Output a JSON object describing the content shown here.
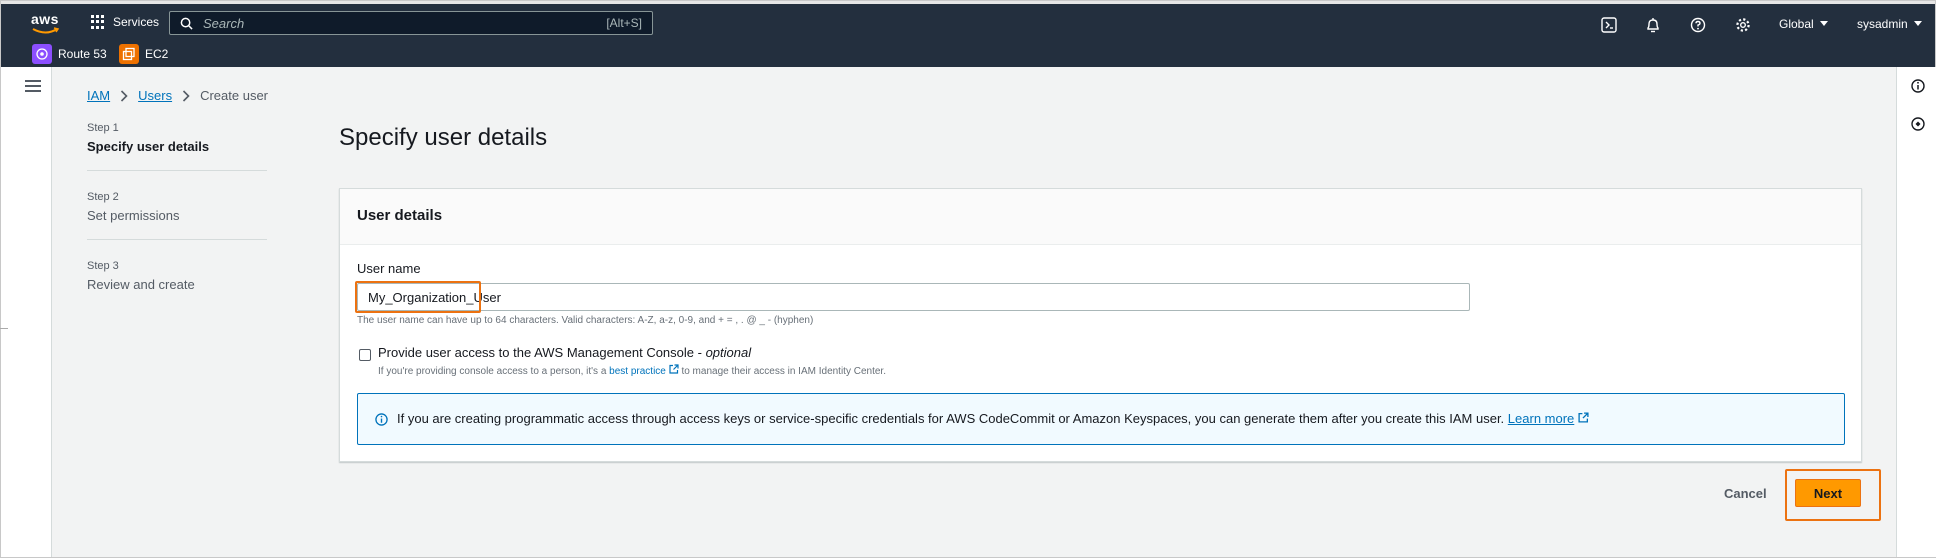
{
  "topnav": {
    "logo_text": "aws",
    "services_label": "Services",
    "search_placeholder": "Search",
    "search_shortcut": "[Alt+S]",
    "region_label": "Global",
    "account_label": "sysadmin",
    "icons": [
      "cloudshell-icon",
      "notifications-icon",
      "help-icon",
      "settings-icon"
    ]
  },
  "favorites": [
    {
      "label": "Route 53",
      "icon": "route53-icon",
      "color": "#8c4fff"
    },
    {
      "label": "EC2",
      "icon": "ec2-icon",
      "color": "#ed7100"
    }
  ],
  "breadcrumb": {
    "items": [
      "IAM",
      "Users"
    ],
    "current": "Create user"
  },
  "steps": [
    {
      "number": "Step 1",
      "title": "Specify user details",
      "active": true
    },
    {
      "number": "Step 2",
      "title": "Set permissions",
      "active": false
    },
    {
      "number": "Step 3",
      "title": "Review and create",
      "active": false
    }
  ],
  "main": {
    "page_title": "Specify user details",
    "panel_title": "User details",
    "username_label": "User name",
    "username_value": "My_Organization_User",
    "username_constraint": "The user name can have up to 64 characters. Valid characters: A-Z, a-z, 0-9, and + = , . @ _ - (hyphen)",
    "console_access_label": "Provide user access to the AWS Management Console -",
    "console_access_optional": "optional",
    "console_desc_prefix": "If you're providing console access to a person, it's a",
    "console_desc_link": "best practice",
    "console_desc_suffix": "to manage their access in IAM Identity Center.",
    "info_text": "If you are creating programmatic access through access keys or service-specific credentials for AWS CodeCommit or Amazon Keyspaces, you can generate them after you create this IAM user.",
    "info_link": "Learn more"
  },
  "actions": {
    "cancel_label": "Cancel",
    "next_label": "Next"
  },
  "colors": {
    "nav_bg": "#232f3e",
    "accent": "#ff9900",
    "highlight": "#ec7211",
    "link": "#0073bb"
  }
}
